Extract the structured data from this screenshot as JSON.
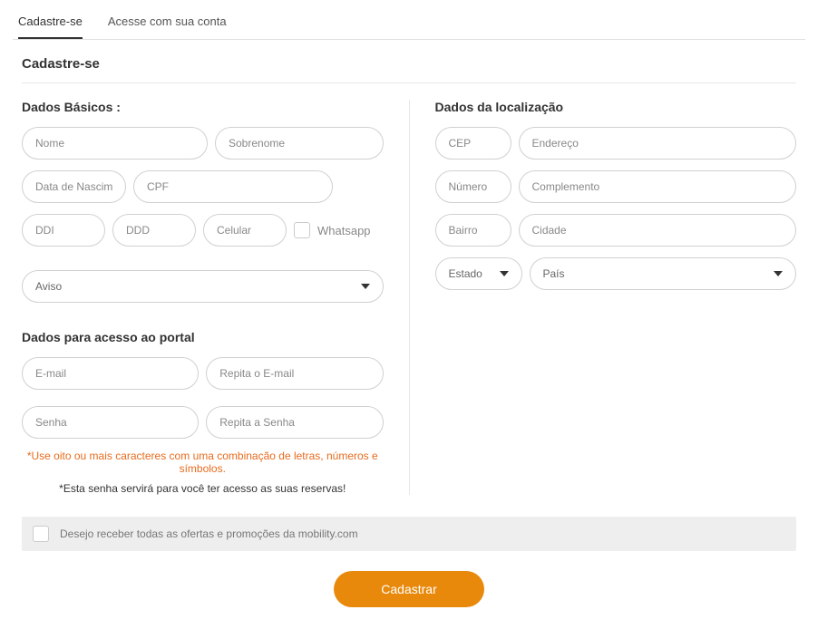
{
  "tabs": {
    "register": "Cadastre-se",
    "login": "Acesse com sua conta"
  },
  "pageTitle": "Cadastre-se",
  "basic": {
    "title": "Dados Básicos :",
    "nome": "Nome",
    "sobrenome": "Sobrenome",
    "dataNasc": "Data de Nascimento",
    "cpf": "CPF",
    "ddi": "DDI",
    "ddd": "DDD",
    "celular": "Celular",
    "whatsapp": "Whatsapp",
    "aviso": "Aviso"
  },
  "access": {
    "title": "Dados para acesso ao portal",
    "email": "E-mail",
    "emailRepeat": "Repita o E-mail",
    "senha": "Senha",
    "senhaRepeat": "Repita a Senha",
    "hint1": "*Use oito ou mais caracteres com uma combinação de letras, números e símbolos.",
    "hint2": "*Esta senha servirá para você ter acesso as suas reservas!"
  },
  "location": {
    "title": "Dados da localização",
    "cep": "CEP",
    "endereco": "Endereço",
    "numero": "Número",
    "complemento": "Complemento",
    "bairro": "Bairro",
    "cidade": "Cidade",
    "estado": "Estado",
    "pais": "País"
  },
  "offers": "Desejo receber todas as ofertas e promoções da mobility.com",
  "submit": "Cadastrar"
}
